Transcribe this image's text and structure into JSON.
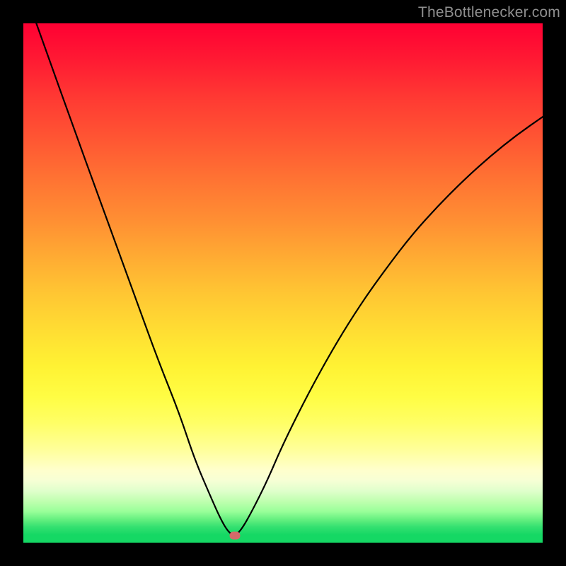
{
  "watermark": "TheBottlenecker.com",
  "marker": {
    "x_pct": 40.7,
    "y_pct": 98.7
  },
  "chart_data": {
    "type": "line",
    "title": "",
    "xlabel": "",
    "ylabel": "",
    "xlim": [
      0,
      100
    ],
    "ylim": [
      0,
      100
    ],
    "x": [
      0,
      5,
      10,
      14,
      18,
      22,
      26,
      30,
      33,
      36,
      38,
      39.5,
      40.7,
      42,
      44,
      47,
      50,
      55,
      60,
      65,
      70,
      75,
      80,
      85,
      90,
      95,
      100
    ],
    "values": [
      107,
      93,
      79,
      68,
      57,
      46,
      35,
      25,
      16,
      9,
      4.5,
      2,
      1.3,
      2.5,
      6,
      12,
      19,
      29,
      38,
      46,
      53,
      59.5,
      65,
      70,
      74.5,
      78.5,
      82
    ],
    "series": [
      {
        "name": "bottleneck-curve",
        "note": "V-shaped curve, minimum at approx x=40.7"
      }
    ],
    "annotations": [
      {
        "name": "optimal-point-marker",
        "x": 40.7,
        "y": 1.3,
        "color": "#d46a6a"
      }
    ],
    "background_gradient": {
      "top": "#ff0033",
      "mid": "#ffe033",
      "bottom": "#15d864"
    }
  }
}
